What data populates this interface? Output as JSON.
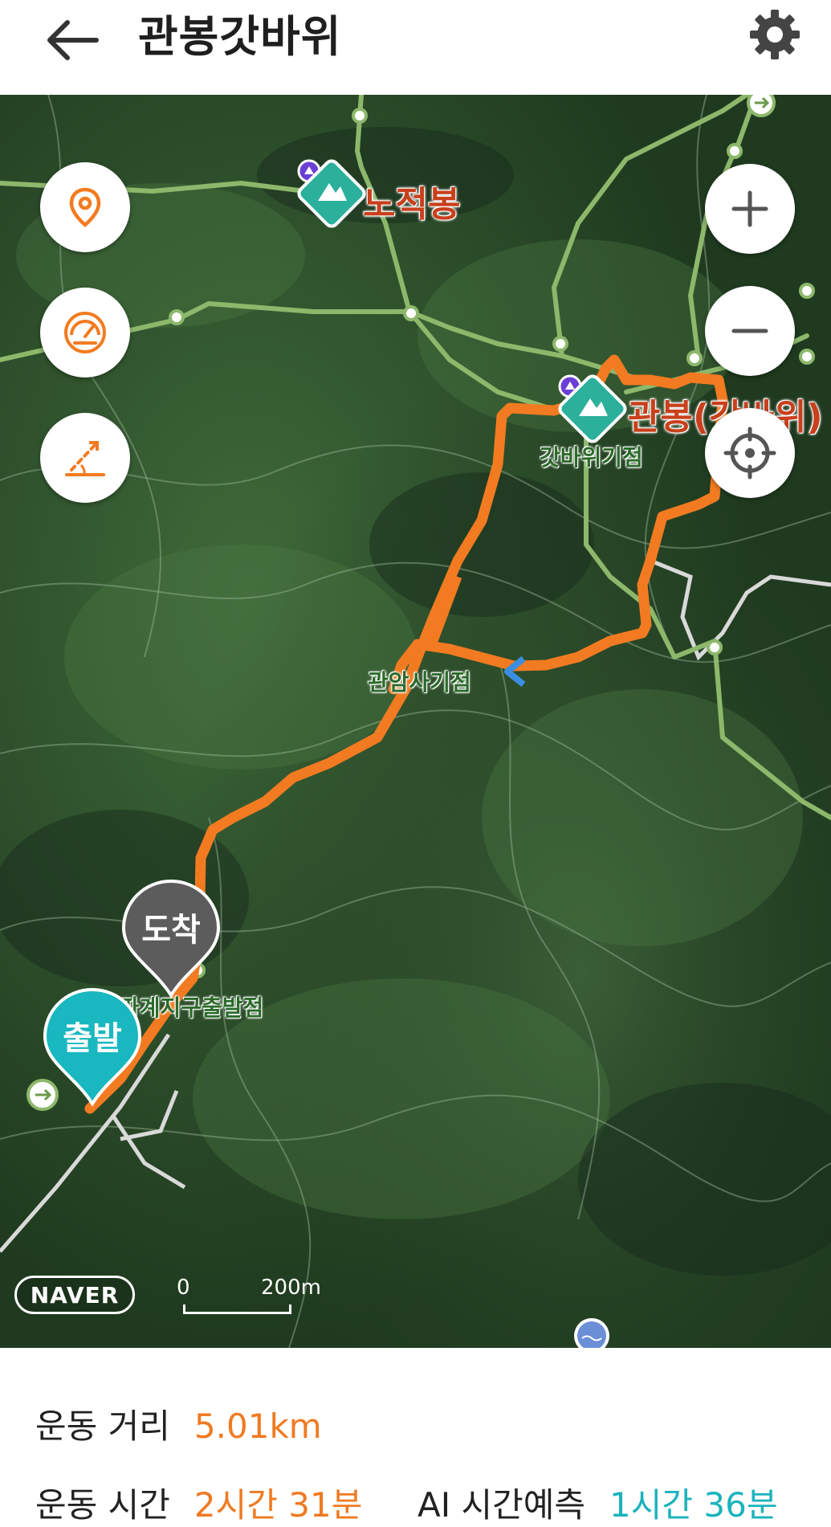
{
  "header": {
    "title": "관봉갓바위",
    "back_icon": "arrow-left-icon",
    "settings_icon": "gear-icon"
  },
  "map": {
    "places": [
      {
        "name": "노적봉"
      },
      {
        "name": "관봉(갓바위)"
      }
    ],
    "sub_labels": [
      {
        "name": "갓바위기점"
      },
      {
        "name": "관암사기점"
      },
      {
        "name": "파계지구출발점"
      }
    ],
    "start_label": "출발",
    "end_label": "도착",
    "provider": "NAVER",
    "scale": {
      "start": "0",
      "end": "200m"
    },
    "controls": {
      "left": [
        "location-pin-icon",
        "speedometer-icon",
        "elevation-icon"
      ],
      "right": [
        "zoom-in-icon",
        "zoom-out-icon",
        "my-location-icon"
      ]
    },
    "route_color": "#f27b21",
    "trail_color": "#8db86b",
    "start_color": "#19b7bf",
    "end_color": "#5c5c5c"
  },
  "stats": {
    "distance_label": "운동 거리",
    "distance_value": "5.01km",
    "time_label": "운동 시간",
    "time_value": "2시간 31분",
    "ai_label": "AI 시간예측",
    "ai_value": "1시간 36분"
  }
}
